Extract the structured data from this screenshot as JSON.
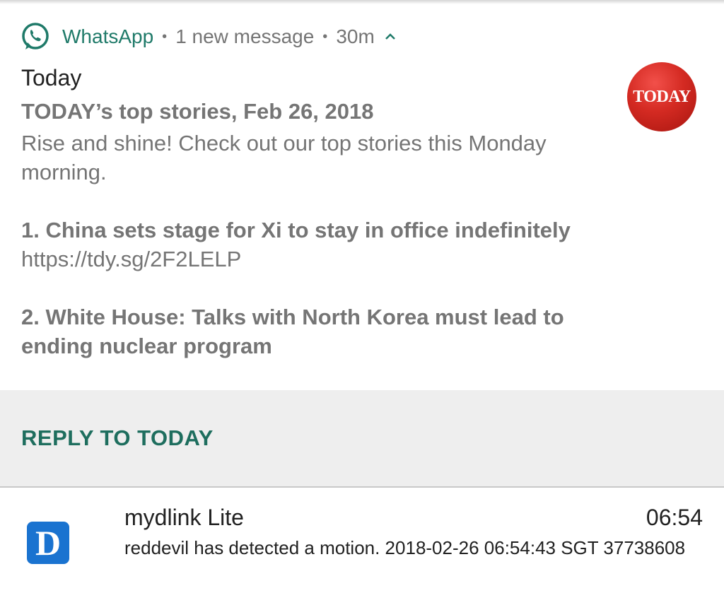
{
  "whatsapp_notification": {
    "app_name": "WhatsApp",
    "summary": "1 new message",
    "time_ago": "30m",
    "sender": "Today",
    "title": "TODAY’s top stories, Feb 26, 2018",
    "intro": "Rise and shine! Check out our top stories this Monday morning.",
    "story1_title": "1. China sets stage for Xi to stay in office indefinitely",
    "story1_link": "https://tdy.sg/2F2LELP",
    "story2_title": "2. White House: Talks with North Korea must lead to ending nuclear program",
    "avatar_text": "TODAY",
    "reply_label": "REPLY TO TODAY",
    "accent_color": "#1f7a69",
    "avatar_color": "#d42a22"
  },
  "mydlink_notification": {
    "app_name": "mydlink Lite",
    "time": "06:54",
    "text": "reddevil has detected a motion. 2018-02-26 06:54:43 SGT 37738608",
    "icon_letter": "D",
    "icon_color": "#1a73d0"
  },
  "icons": {
    "whatsapp": "whatsapp-icon",
    "expand": "chevron-up-icon",
    "mydlink": "mydlink-app-icon"
  }
}
